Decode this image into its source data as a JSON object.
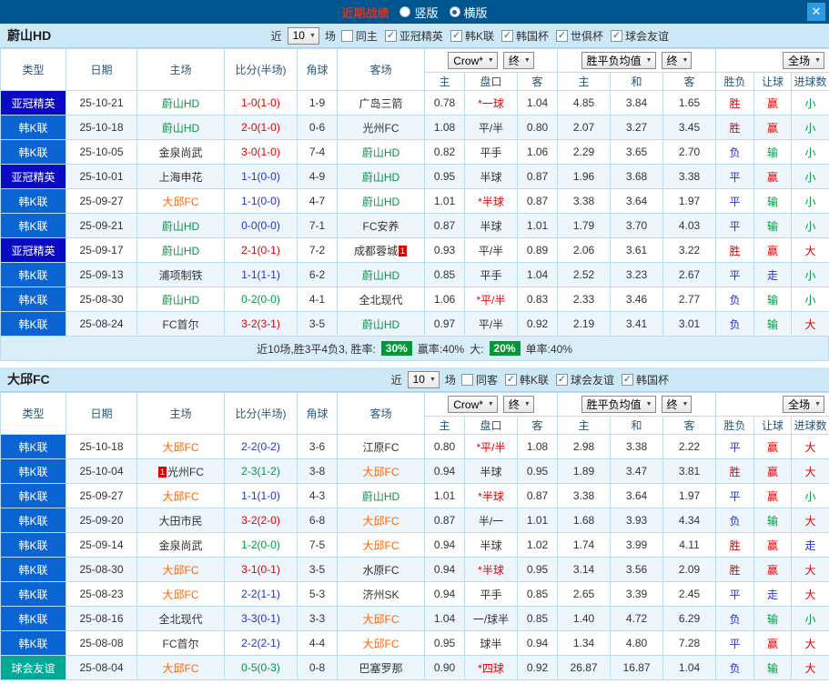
{
  "titlebar": {
    "title": "近期战绩",
    "radios": [
      {
        "label": "竖版",
        "selected": false
      },
      {
        "label": "横版",
        "selected": true
      }
    ],
    "close_icon": "✕"
  },
  "colors": {
    "titlebar_bg": "#00568e",
    "section_header_bg": "#cde9f8",
    "type_acl_elite": "#0a0ac4",
    "type_k_league": "#0a64d2",
    "type_club_friendly": "#00a896",
    "win_red": "#e60000",
    "draw_blue": "#2233cc",
    "loss_green": "#009944",
    "team_ulsan_green": "#009944",
    "team_daegu_orange": "#ff6600",
    "rate_badge_green": "#009933"
  },
  "columns": {
    "type": "类型",
    "date": "日期",
    "home": "主场",
    "score": "比分(半场)",
    "corner": "角球",
    "away": "客场",
    "odds_home": "主",
    "odds_hcap": "盘口",
    "odds_away": "客",
    "avg_home": "主",
    "avg_draw": "和",
    "avg_away": "客",
    "wdl": "胜负",
    "hcap_result": "让球",
    "goals": "进球数"
  },
  "sections": [
    {
      "team": "蔚山HD",
      "filters": {
        "near": "近",
        "count": "10",
        "unit": "场",
        "checkboxes": [
          {
            "label": "同主",
            "checked": false
          },
          {
            "label": "亚冠精英",
            "checked": true
          },
          {
            "label": "韩K联",
            "checked": true
          },
          {
            "label": "韩国杯",
            "checked": true
          },
          {
            "label": "世俱杯",
            "checked": true
          },
          {
            "label": "球会友谊",
            "checked": true
          }
        ]
      },
      "selects": {
        "company": "Crow*",
        "company_state": "终",
        "avg": "胜平负均值",
        "avg_state": "终",
        "scope": "全场"
      },
      "rows": [
        {
          "type": "亚冠精英",
          "tcls": "acl",
          "date": "25-10-21",
          "home": "蔚山HD",
          "homec": "green",
          "score": "1-0(1-0)",
          "scorec": "red",
          "corner": "1-9",
          "away": "广岛三箭",
          "awayc": "",
          "o": [
            "0.78",
            "*一球",
            "1.04"
          ],
          "ored": true,
          "avg": [
            "4.85",
            "3.84",
            "1.65"
          ],
          "wdl": "胜",
          "wdlc": "red",
          "hr": "赢",
          "hrc": "red",
          "gl": "小",
          "glc": "green"
        },
        {
          "type": "韩K联",
          "tcls": "kl",
          "date": "25-10-18",
          "home": "蔚山HD",
          "homec": "green",
          "score": "2-0(1-0)",
          "scorec": "red",
          "corner": "0-6",
          "away": "光州FC",
          "awayc": "",
          "o": [
            "1.08",
            "平/半",
            "0.80"
          ],
          "ored": false,
          "avg": [
            "2.07",
            "3.27",
            "3.45"
          ],
          "wdl": "胜",
          "wdlc": "red",
          "hr": "赢",
          "hrc": "red",
          "gl": "小",
          "glc": "green"
        },
        {
          "type": "韩K联",
          "tcls": "kl",
          "date": "25-10-05",
          "home": "金泉尚武",
          "homec": "",
          "score": "3-0(1-0)",
          "scorec": "red",
          "corner": "7-4",
          "away": "蔚山HD",
          "awayc": "green",
          "o": [
            "0.82",
            "平手",
            "1.06"
          ],
          "ored": false,
          "avg": [
            "2.29",
            "3.65",
            "2.70"
          ],
          "wdl": "负",
          "wdlc": "blue",
          "hr": "输",
          "hrc": "green",
          "gl": "小",
          "glc": "green"
        },
        {
          "type": "亚冠精英",
          "tcls": "acl",
          "date": "25-10-01",
          "home": "上海申花",
          "homec": "",
          "score": "1-1(0-0)",
          "scorec": "blue",
          "corner": "4-9",
          "away": "蔚山HD",
          "awayc": "green",
          "o": [
            "0.95",
            "半球",
            "0.87"
          ],
          "ored": false,
          "avg": [
            "1.96",
            "3.68",
            "3.38"
          ],
          "wdl": "平",
          "wdlc": "blue",
          "hr": "赢",
          "hrc": "red",
          "gl": "小",
          "glc": "green"
        },
        {
          "type": "韩K联",
          "tcls": "kl",
          "date": "25-09-27",
          "home": "大邱FC",
          "homec": "orange",
          "score": "1-1(0-0)",
          "scorec": "blue",
          "corner": "4-7",
          "away": "蔚山HD",
          "awayc": "green",
          "o": [
            "1.01",
            "*半球",
            "0.87"
          ],
          "ored": true,
          "avg": [
            "3.38",
            "3.64",
            "1.97"
          ],
          "wdl": "平",
          "wdlc": "blue",
          "hr": "输",
          "hrc": "green",
          "gl": "小",
          "glc": "green"
        },
        {
          "type": "韩K联",
          "tcls": "kl",
          "date": "25-09-21",
          "home": "蔚山HD",
          "homec": "green",
          "score": "0-0(0-0)",
          "scorec": "blue",
          "corner": "7-1",
          "away": "FC安养",
          "awayc": "",
          "o": [
            "0.87",
            "半球",
            "1.01"
          ],
          "ored": false,
          "avg": [
            "1.79",
            "3.70",
            "4.03"
          ],
          "wdl": "平",
          "wdlc": "blue",
          "hr": "输",
          "hrc": "green",
          "gl": "小",
          "glc": "green"
        },
        {
          "type": "亚冠精英",
          "tcls": "acl",
          "date": "25-09-17",
          "home": "蔚山HD",
          "homec": "green",
          "score": "2-1(0-1)",
          "scorec": "red",
          "corner": "7-2",
          "away": "成都蓉城",
          "awayc": "",
          "awayBadge": "1",
          "o": [
            "0.93",
            "平/半",
            "0.89"
          ],
          "ored": false,
          "avg": [
            "2.06",
            "3.61",
            "3.22"
          ],
          "wdl": "胜",
          "wdlc": "red",
          "hr": "赢",
          "hrc": "red",
          "gl": "大",
          "glc": "red"
        },
        {
          "type": "韩K联",
          "tcls": "kl",
          "date": "25-09-13",
          "home": "浦项制铁",
          "homec": "",
          "score": "1-1(1-1)",
          "scorec": "blue",
          "corner": "6-2",
          "away": "蔚山HD",
          "awayc": "green",
          "o": [
            "0.85",
            "平手",
            "1.04"
          ],
          "ored": false,
          "avg": [
            "2.52",
            "3.23",
            "2.67"
          ],
          "wdl": "平",
          "wdlc": "blue",
          "hr": "走",
          "hrc": "blue",
          "gl": "小",
          "glc": "green"
        },
        {
          "type": "韩K联",
          "tcls": "kl",
          "date": "25-08-30",
          "home": "蔚山HD",
          "homec": "green",
          "score": "0-2(0-0)",
          "scorec": "green",
          "corner": "4-1",
          "away": "全北现代",
          "awayc": "",
          "o": [
            "1.06",
            "*平/半",
            "0.83"
          ],
          "ored": true,
          "avg": [
            "2.33",
            "3.46",
            "2.77"
          ],
          "wdl": "负",
          "wdlc": "blue",
          "hr": "输",
          "hrc": "green",
          "gl": "小",
          "glc": "green"
        },
        {
          "type": "韩K联",
          "tcls": "kl",
          "date": "25-08-24",
          "home": "FC首尔",
          "homec": "",
          "score": "3-2(3-1)",
          "scorec": "red",
          "corner": "3-5",
          "away": "蔚山HD",
          "awayc": "green",
          "o": [
            "0.97",
            "平/半",
            "0.92"
          ],
          "ored": false,
          "avg": [
            "2.19",
            "3.41",
            "3.01"
          ],
          "wdl": "负",
          "wdlc": "blue",
          "hr": "输",
          "hrc": "green",
          "gl": "大",
          "glc": "red"
        }
      ],
      "summary": {
        "seg1": "近10场,胜3平4负3, 胜率:",
        "win_rate": "30%",
        "seg2": "赢率:40%",
        "seg3": "大:",
        "big_rate": "20%",
        "seg4": "单率:40%"
      }
    },
    {
      "team": "大邱FC",
      "filters": {
        "near": "近",
        "count": "10",
        "unit": "场",
        "checkboxes": [
          {
            "label": "同客",
            "checked": false
          },
          {
            "label": "韩K联",
            "checked": true
          },
          {
            "label": "球会友谊",
            "checked": true
          },
          {
            "label": "韩国杯",
            "checked": true
          }
        ]
      },
      "selects": {
        "company": "Crow*",
        "company_state": "终",
        "avg": "胜平负均值",
        "avg_state": "终",
        "scope": "全场"
      },
      "rows": [
        {
          "type": "韩K联",
          "tcls": "kl",
          "date": "25-10-18",
          "home": "大邱FC",
          "homec": "orange",
          "score": "2-2(0-2)",
          "scorec": "blue",
          "corner": "3-6",
          "away": "江原FC",
          "awayc": "",
          "o": [
            "0.80",
            "*平/半",
            "1.08"
          ],
          "ored": true,
          "avg": [
            "2.98",
            "3.38",
            "2.22"
          ],
          "wdl": "平",
          "wdlc": "blue",
          "hr": "赢",
          "hrc": "red",
          "gl": "大",
          "glc": "red"
        },
        {
          "type": "韩K联",
          "tcls": "kl",
          "date": "25-10-04",
          "home": "光州FC",
          "homec": "",
          "homeBadge": "1",
          "score": "2-3(1-2)",
          "scorec": "green",
          "corner": "3-8",
          "away": "大邱FC",
          "awayc": "orange",
          "o": [
            "0.94",
            "半球",
            "0.95"
          ],
          "ored": false,
          "avg": [
            "1.89",
            "3.47",
            "3.81"
          ],
          "wdl": "胜",
          "wdlc": "red",
          "hr": "赢",
          "hrc": "red",
          "gl": "大",
          "glc": "red"
        },
        {
          "type": "韩K联",
          "tcls": "kl",
          "date": "25-09-27",
          "home": "大邱FC",
          "homec": "orange",
          "score": "1-1(1-0)",
          "scorec": "blue",
          "corner": "4-3",
          "away": "蔚山HD",
          "awayc": "green",
          "o": [
            "1.01",
            "*半球",
            "0.87"
          ],
          "ored": true,
          "avg": [
            "3.38",
            "3.64",
            "1.97"
          ],
          "wdl": "平",
          "wdlc": "blue",
          "hr": "赢",
          "hrc": "red",
          "gl": "小",
          "glc": "green"
        },
        {
          "type": "韩K联",
          "tcls": "kl",
          "date": "25-09-20",
          "home": "大田市民",
          "homec": "",
          "score": "3-2(2-0)",
          "scorec": "red",
          "corner": "6-8",
          "away": "大邱FC",
          "awayc": "orange",
          "o": [
            "0.87",
            "半/一",
            "1.01"
          ],
          "ored": false,
          "avg": [
            "1.68",
            "3.93",
            "4.34"
          ],
          "wdl": "负",
          "wdlc": "blue",
          "hr": "输",
          "hrc": "green",
          "gl": "大",
          "glc": "red"
        },
        {
          "type": "韩K联",
          "tcls": "kl",
          "date": "25-09-14",
          "home": "金泉尚武",
          "homec": "",
          "score": "1-2(0-0)",
          "scorec": "green",
          "corner": "7-5",
          "away": "大邱FC",
          "awayc": "orange",
          "o": [
            "0.94",
            "半球",
            "1.02"
          ],
          "ored": false,
          "avg": [
            "1.74",
            "3.99",
            "4.11"
          ],
          "wdl": "胜",
          "wdlc": "red",
          "hr": "赢",
          "hrc": "red",
          "gl": "走",
          "glc": "blue"
        },
        {
          "type": "韩K联",
          "tcls": "kl",
          "date": "25-08-30",
          "home": "大邱FC",
          "homec": "orange",
          "score": "3-1(0-1)",
          "scorec": "red",
          "corner": "3-5",
          "away": "水原FC",
          "awayc": "",
          "o": [
            "0.94",
            "*半球",
            "0.95"
          ],
          "ored": true,
          "avg": [
            "3.14",
            "3.56",
            "2.09"
          ],
          "wdl": "胜",
          "wdlc": "red",
          "hr": "赢",
          "hrc": "red",
          "gl": "大",
          "glc": "red"
        },
        {
          "type": "韩K联",
          "tcls": "kl",
          "date": "25-08-23",
          "home": "大邱FC",
          "homec": "orange",
          "score": "2-2(1-1)",
          "scorec": "blue",
          "corner": "5-3",
          "away": "济州SK",
          "awayc": "",
          "o": [
            "0.94",
            "平手",
            "0.85"
          ],
          "ored": false,
          "avg": [
            "2.65",
            "3.39",
            "2.45"
          ],
          "wdl": "平",
          "wdlc": "blue",
          "hr": "走",
          "hrc": "blue",
          "gl": "大",
          "glc": "red"
        },
        {
          "type": "韩K联",
          "tcls": "kl",
          "date": "25-08-16",
          "home": "全北现代",
          "homec": "",
          "score": "3-3(0-1)",
          "scorec": "blue",
          "corner": "3-3",
          "away": "大邱FC",
          "awayc": "orange",
          "o": [
            "1.04",
            "一/球半",
            "0.85"
          ],
          "ored": false,
          "avg": [
            "1.40",
            "4.72",
            "6.29"
          ],
          "wdl": "负",
          "wdlc": "blue",
          "hr": "输",
          "hrc": "green",
          "gl": "小",
          "glc": "green"
        },
        {
          "type": "韩K联",
          "tcls": "kl",
          "date": "25-08-08",
          "home": "FC首尔",
          "homec": "",
          "score": "2-2(2-1)",
          "scorec": "blue",
          "corner": "4-4",
          "away": "大邱FC",
          "awayc": "orange",
          "o": [
            "0.95",
            "球半",
            "0.94"
          ],
          "ored": false,
          "avg": [
            "1.34",
            "4.80",
            "7.28"
          ],
          "wdl": "平",
          "wdlc": "blue",
          "hr": "赢",
          "hrc": "red",
          "gl": "大",
          "glc": "red"
        },
        {
          "type": "球会友谊",
          "tcls": "fr",
          "date": "25-08-04",
          "home": "大邱FC",
          "homec": "orange",
          "score": "0-5(0-3)",
          "scorec": "green",
          "corner": "0-8",
          "away": "巴塞罗那",
          "awayc": "",
          "o": [
            "0.90",
            "*四球",
            "0.92"
          ],
          "ored": true,
          "avg": [
            "26.87",
            "16.87",
            "1.04"
          ],
          "wdl": "负",
          "wdlc": "blue",
          "hr": "输",
          "hrc": "green",
          "gl": "大",
          "glc": "red"
        }
      ]
    }
  ]
}
